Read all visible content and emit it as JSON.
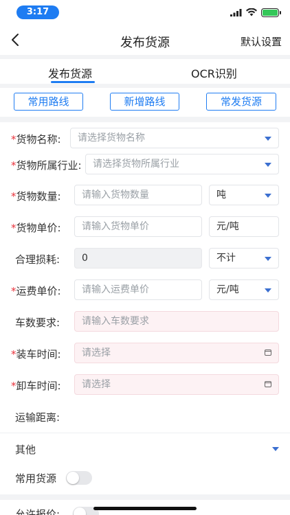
{
  "status_bar": {
    "time": "3:17"
  },
  "nav": {
    "back_label": "<",
    "title": "发布货源",
    "right_action": "默认设置"
  },
  "tabs": [
    {
      "label": "发布货源",
      "active": true
    },
    {
      "label": "OCR识别",
      "active": false
    }
  ],
  "route_buttons": [
    "常用路线",
    "新增路线",
    "常发货源"
  ],
  "form": {
    "cargo_name": {
      "label": "货物名称:",
      "placeholder": "请选择货物名称"
    },
    "industry": {
      "label": "货物所属行业:",
      "placeholder": "请选择货物所属行业"
    },
    "quantity": {
      "label": "货物数量:",
      "placeholder": "请输入货物数量",
      "unit": "吨"
    },
    "unit_price": {
      "label": "货物单价:",
      "placeholder": "请输入货物单价",
      "unit": "元/吨"
    },
    "loss": {
      "label": "合理损耗:",
      "value": "0",
      "option": "不计"
    },
    "freight_price": {
      "label": "运费单价:",
      "placeholder": "请输入运费单价",
      "unit": "元/吨"
    },
    "truck_count": {
      "label": "车数要求:",
      "placeholder": "请输入车数要求"
    },
    "load_time": {
      "label": "装车时间:",
      "placeholder": "请选择"
    },
    "unload_time": {
      "label": "卸车时间:",
      "placeholder": "请选择"
    },
    "distance": {
      "label": "运输距离:"
    },
    "other": {
      "label": "其他"
    },
    "common_cargo": {
      "label": "常用货源",
      "enabled": false
    }
  },
  "bottom": {
    "label": "允许报价:",
    "enabled": false
  },
  "colors": {
    "accent": "#1e7cf2",
    "required": "#e8333c",
    "pink_field": "#fdf2f4"
  }
}
